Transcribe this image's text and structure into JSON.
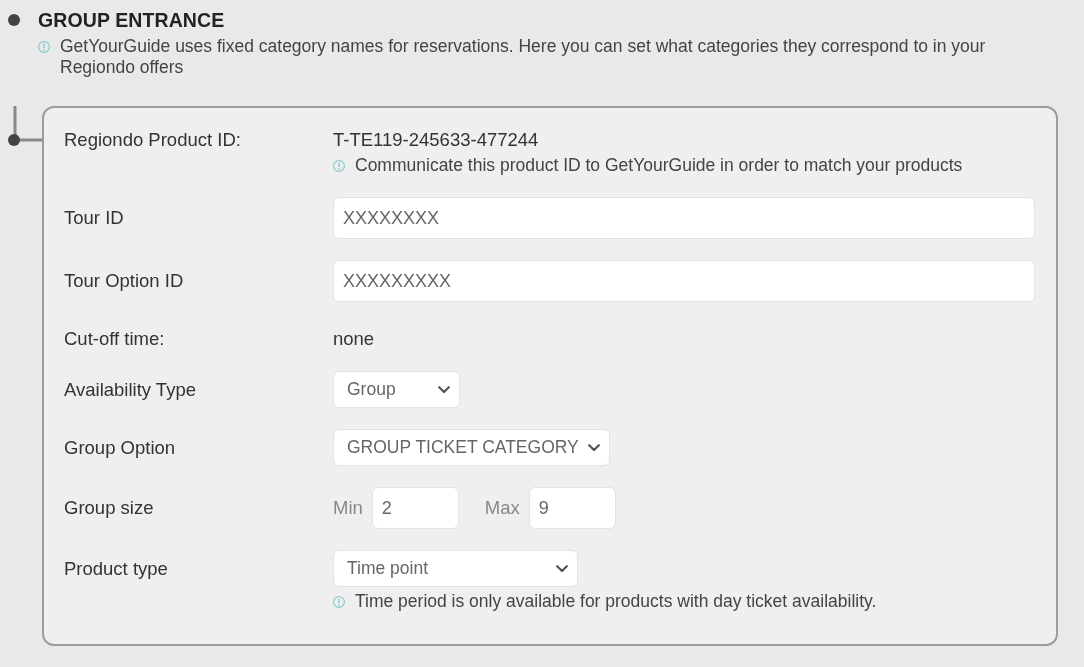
{
  "section": {
    "title": "GROUP ENTRANCE",
    "info": "GetYourGuide uses fixed category names for reservations. Here you can set what categories they correspond to in your Regiondo offers"
  },
  "form": {
    "rows": [
      {
        "kind": "text",
        "label": "Regiondo Product ID:",
        "value": "T-TE119-245633-477244",
        "hint": "Communicate this product ID to GetYourGuide in order to match your products"
      },
      {
        "kind": "input",
        "label": "Tour ID",
        "value": "XXXXXXXX"
      },
      {
        "kind": "input",
        "label": "Tour Option ID",
        "value": "XXXXXXXXX"
      },
      {
        "kind": "text",
        "label": "Cut-off time:",
        "value": "none"
      },
      {
        "kind": "select",
        "label": "Availability Type",
        "value": "Group"
      },
      {
        "kind": "select",
        "label": "Group Option",
        "value": "GROUP TICKET CATEGORY"
      },
      {
        "kind": "range",
        "label": "Group size",
        "min_label": "Min",
        "min_value": "2",
        "max_label": "Max",
        "max_value": "9"
      },
      {
        "kind": "select",
        "label": "Product type",
        "value": "Time point",
        "hint": "Time period is only available for products with day ticket availability."
      }
    ]
  }
}
